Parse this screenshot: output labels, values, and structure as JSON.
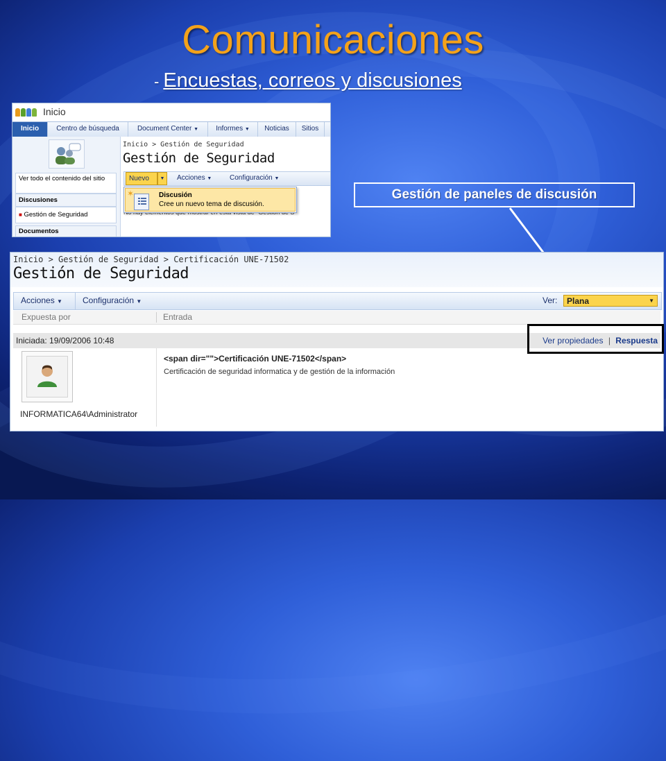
{
  "slide": {
    "title": "Comunicaciones",
    "subtitle_dash": "-",
    "subtitle": "Encuestas, correos y discusiones",
    "callout": "Gestión de paneles de discusión"
  },
  "shot1": {
    "site_title": "Inicio",
    "nav": [
      "Inicio",
      "Centro de búsqueda",
      "Document Center",
      "Informes",
      "Noticias",
      "Sitios"
    ],
    "nav_dropdown_marks": [
      "▼",
      "▼"
    ],
    "breadcrumb": "Inicio > Gestión de Seguridad",
    "page_title": "Gestión de Seguridad",
    "quicklaunch": {
      "view_all": "Ver todo el contenido del sitio",
      "section": "Discusiones",
      "item": "Gestión de Seguridad",
      "section2": "Documentos"
    },
    "toolbar": {
      "nuevo": "Nuevo",
      "acciones": "Acciones",
      "configuracion": "Configuración",
      "caret": "▼"
    },
    "menu": {
      "item_title": "Discusión",
      "item_desc": "Cree un nuevo tema de discusión."
    },
    "partial_text": "No hay elementos que mostrar en esta vista de \"Gestión de S"
  },
  "shot2": {
    "breadcrumb": "Inicio > Gestión de Seguridad > Certificación UNE-71502",
    "page_title": "Gestión de Seguridad",
    "toolbar": {
      "acciones": "Acciones",
      "configuracion": "Configuración",
      "caret": "▼",
      "ver_label": "Ver:",
      "view": "Plana"
    },
    "columns": [
      "Expuesta por",
      "Entrada"
    ],
    "row": {
      "started": "Iniciada: 19/09/2006 10:48",
      "ver_propiedades": "Ver propiedades",
      "separator": "|",
      "respuesta": "Respuesta"
    },
    "author": "INFORMATICA64\\Administrator",
    "entry_title": "<span dir=\"\">Certificación UNE-71502</span>",
    "entry_body": "Certificación de seguridad informatica y de gestión de la información"
  },
  "colors": {
    "title": "#f4a21a",
    "accent_nav": "#2b5fae",
    "menu_highlight": "#fde7a6",
    "view_select": "#fbd44c"
  }
}
